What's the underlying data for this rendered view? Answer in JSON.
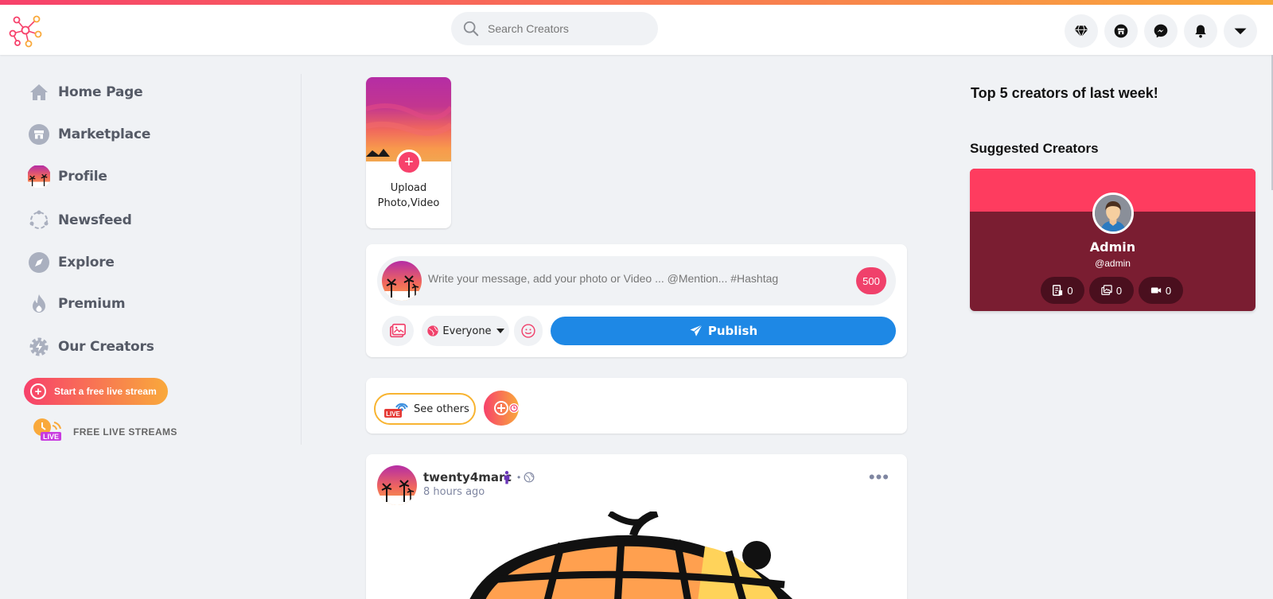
{
  "header": {
    "search_placeholder": "Search Creators",
    "icons": [
      "diamond-icon",
      "store-icon",
      "messenger-icon",
      "bell-icon",
      "caret-down-icon"
    ]
  },
  "sidebar": {
    "items": [
      {
        "label": "Home Page",
        "icon": "home-icon"
      },
      {
        "label": "Marketplace",
        "icon": "store-icon"
      },
      {
        "label": "Profile",
        "icon": "avatar"
      },
      {
        "label": "Newsfeed",
        "icon": "newsfeed-icon"
      },
      {
        "label": "Explore",
        "icon": "compass-icon"
      },
      {
        "label": "Premium",
        "icon": "flame-icon"
      },
      {
        "label": "Our Creators",
        "icon": "gear-bolt-icon"
      }
    ],
    "live_button": "Start a free live stream",
    "free_live_label": "FREE LIVE STREAMS"
  },
  "story": {
    "label_line1": "Upload",
    "label_line2": "Photo,Video"
  },
  "composer": {
    "placeholder": "Write your message, add your photo or Video ... @Mention... #Hashtag",
    "char_count": "500",
    "privacy": "Everyone",
    "publish": "Publish"
  },
  "live_bar": {
    "see_others": "See others"
  },
  "post": {
    "author": "twenty4marc",
    "time": "8 hours ago"
  },
  "right": {
    "top_title": "Top 5 creators of last week!",
    "suggested_title": "Suggested Creators",
    "creator": {
      "name": "Admin",
      "handle": "@admin",
      "posts": "0",
      "photos": "0",
      "videos": "0"
    }
  },
  "colors": {
    "accent_pink": "#f7416b",
    "accent_orange": "#f9a93b",
    "publish_blue": "#1e88e5",
    "card_cover": "#fe3c5f",
    "card_body": "#7a1d31"
  }
}
